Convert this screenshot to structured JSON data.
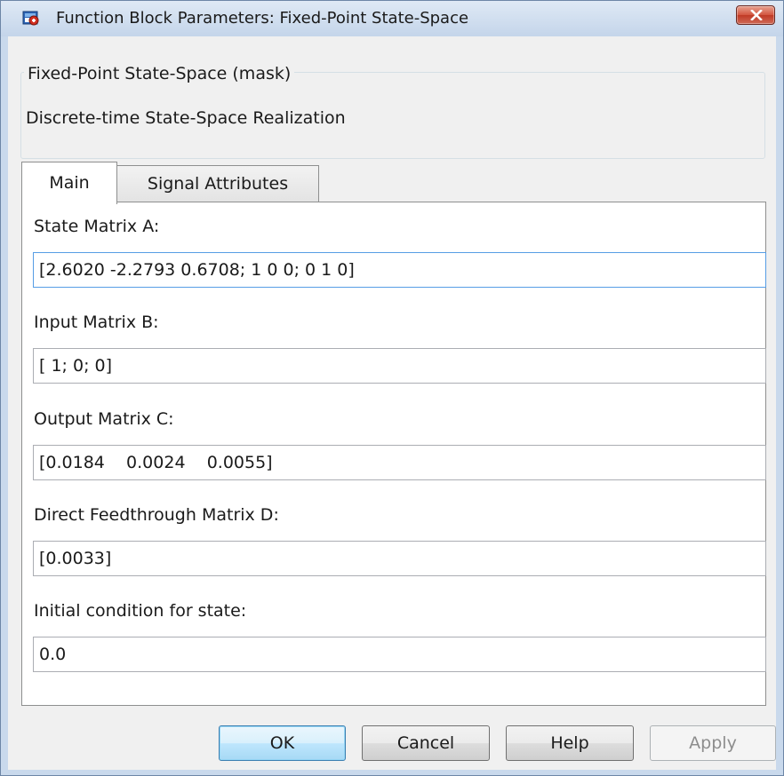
{
  "window": {
    "title": "Function Block Parameters: Fixed-Point State-Space",
    "close_icon": "close-icon",
    "app_icon": "simulink-block-icon"
  },
  "description": {
    "block_type": "Fixed-Point State-Space (mask)",
    "text": "Discrete-time State-Space Realization"
  },
  "tabs": [
    {
      "label": "Main",
      "selected": true
    },
    {
      "label": "Signal Attributes",
      "selected": false
    }
  ],
  "parameters": [
    {
      "label": "State Matrix A:",
      "value": "[2.6020 -2.2793 0.6708; 1 0 0; 0 1 0]"
    },
    {
      "label": "Input Matrix B:",
      "value": "[ 1; 0; 0]"
    },
    {
      "label": "Output Matrix C:",
      "value": "[0.0184    0.0024    0.0055]"
    },
    {
      "label": "Direct Feedthrough Matrix D:",
      "value": "[0.0033]"
    },
    {
      "label": "Initial condition for state:",
      "value": "0.0"
    }
  ],
  "buttons": {
    "ok": "OK",
    "cancel": "Cancel",
    "help": "Help",
    "apply": "Apply",
    "apply_enabled": false
  },
  "colors": {
    "window_frame": "#c9d9ec",
    "client_background": "#f0f0f0",
    "close_button": "#c74331",
    "focus_border": "#569de5",
    "default_button": "#bee6fd"
  }
}
